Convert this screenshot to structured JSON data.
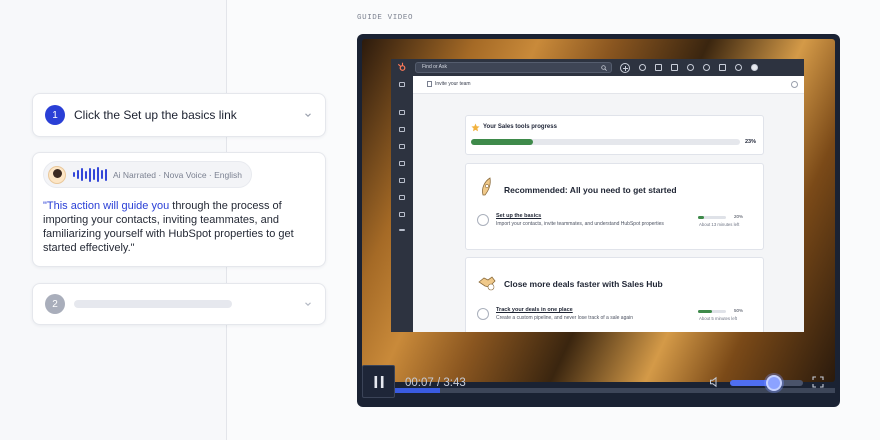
{
  "steps": [
    {
      "number": "1",
      "title": "Click the Set up the basics link"
    },
    {
      "number": "2"
    }
  ],
  "narration": {
    "meta": "Ai Narrated · Nova Voice · English",
    "highlight": "\"This action will guide you",
    "text": " through the process of importing your contacts, inviting teammates, and familiarizing yourself with HubSpot properties to get started effectively.\""
  },
  "guide_label": "GUIDE VIDEO",
  "player": {
    "time": "00:07 / 3:43",
    "progress": 0.164,
    "volume": 0.6
  },
  "app": {
    "search_placeholder": "Find or Ask",
    "header_title": "Invite your team",
    "progress_card": {
      "title": "Your Sales tools progress",
      "percent_label": "23%",
      "percent": 0.23
    },
    "sections": [
      {
        "title": "Recommended: All you need to get started",
        "item": {
          "link": "Set up the basics",
          "desc": "Import your contacts, invite teammates, and understand HubSpot properties",
          "percent_label": "20%",
          "percent": 0.2,
          "time_left": "About 13 minutes left"
        }
      },
      {
        "title": "Close more deals faster with Sales Hub",
        "item": {
          "link": "Track your deals in one place",
          "desc": "Create a custom pipeline, and never lose track of a sale again",
          "percent_label": "50%",
          "percent": 0.5,
          "time_left": "About 5 minutes left"
        }
      }
    ]
  },
  "colors": {
    "accent": "#2a3fd6",
    "player_bg": "#1a2233",
    "progress_green": "#3e8a4a"
  }
}
